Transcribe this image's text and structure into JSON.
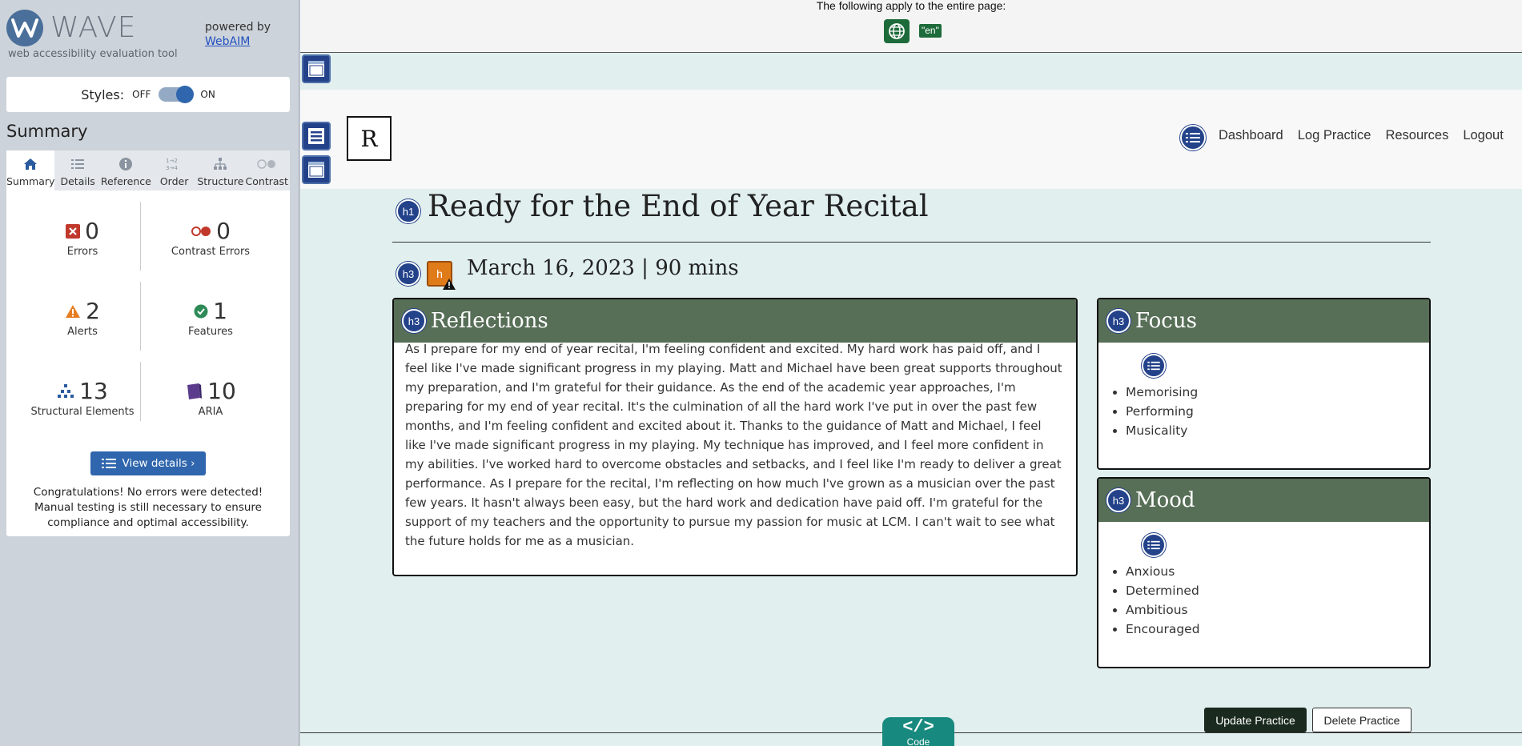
{
  "wave": {
    "title": "WAVE",
    "subtitle": "web accessibility evaluation tool",
    "powered_by": "powered by",
    "webaim_link": "WebAIM",
    "styles_label": "Styles:",
    "styles_off": "OFF",
    "styles_on": "ON",
    "summary_heading": "Summary",
    "tabs": [
      {
        "label": "Summary",
        "icon": "home-icon",
        "active": true
      },
      {
        "label": "Details",
        "icon": "list-icon"
      },
      {
        "label": "Reference",
        "icon": "info-icon"
      },
      {
        "label": "Order",
        "icon": "order-icon"
      },
      {
        "label": "Structure",
        "icon": "structure-icon"
      },
      {
        "label": "Contrast",
        "icon": "contrast-icon"
      }
    ],
    "stats": {
      "errors": {
        "value": "0",
        "label": "Errors",
        "icon": "error-icon",
        "color": "#c0392b"
      },
      "contrast": {
        "value": "0",
        "label": "Contrast Errors",
        "icon": "contrast-error-icon",
        "color": "#c0392b"
      },
      "alerts": {
        "value": "2",
        "label": "Alerts",
        "icon": "alert-icon",
        "color": "#e67e22"
      },
      "features": {
        "value": "1",
        "label": "Features",
        "icon": "feature-icon",
        "color": "#2e8b57"
      },
      "structural": {
        "value": "13",
        "label": "Structural Elements",
        "icon": "structure-icon",
        "color": "#2a5aa0"
      },
      "aria": {
        "value": "10",
        "label": "ARIA",
        "icon": "aria-icon",
        "color": "#5b3b8c"
      }
    },
    "view_details": "View details ›",
    "congrats": "Congratulations! No errors were detected! Manual testing is still necessary to ensure compliance and optimal accessibility."
  },
  "page": {
    "top_note": "The following apply to the entire page:",
    "lang_badge": "\"en\"",
    "brand": "R",
    "nav": [
      "Dashboard",
      "Log Practice",
      "Resources",
      "Logout"
    ],
    "h1_badge": "h1",
    "h3_badge": "h3",
    "title": "Ready for the End of Year Recital",
    "date_line": "March 16, 2023 | 90 mins",
    "reflections": {
      "title": "Reflections",
      "body": "As I prepare for my end of year recital, I'm feeling confident and excited. My hard work has paid off, and I feel like I've made significant progress in my playing. Matt and Michael have been great supports throughout my preparation, and I'm grateful for their guidance. As the end of the academic year approaches, I'm preparing for my end of year recital. It's the culmination of all the hard work I've put in over the past few months, and I'm feeling confident and excited about it. Thanks to the guidance of Matt and Michael, I feel like I've made significant progress in my playing. My technique has improved, and I feel more confident in my abilities. I've worked hard to overcome obstacles and setbacks, and I feel like I'm ready to deliver a great performance. As I prepare for the recital, I'm reflecting on how much I've grown as a musician over the past few years. It hasn't always been easy, but the hard work and dedication have paid off. I'm grateful for the support of my teachers and the opportunity to pursue my passion for music at LCM. I can't wait to see what the future holds for me as a musician."
    },
    "focus": {
      "title": "Focus",
      "items": [
        "Memorising",
        "Performing",
        "Musicality"
      ]
    },
    "mood": {
      "title": "Mood",
      "items": [
        "Anxious",
        "Determined",
        "Ambitious",
        "Encouraged"
      ]
    },
    "update_button": "Update Practice",
    "delete_button": "Delete Practice",
    "code_tab": "</>",
    "code_word": "Code"
  }
}
